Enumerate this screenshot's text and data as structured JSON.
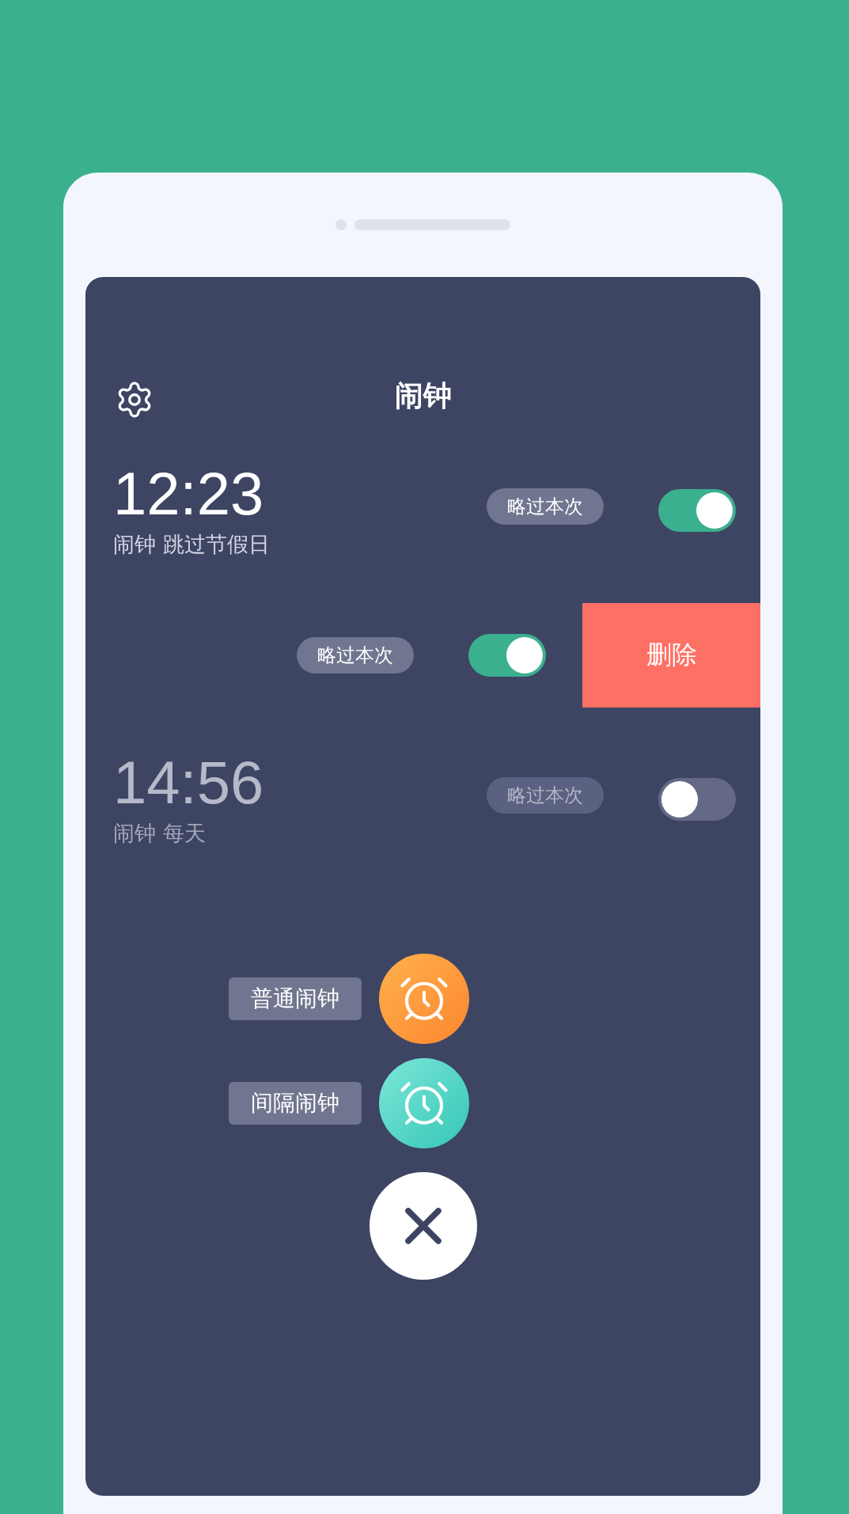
{
  "header": {
    "title": "闹钟"
  },
  "alarms": [
    {
      "time": "12:23",
      "label": "闹钟 跳过节假日",
      "skip_label": "略过本次",
      "enabled": true,
      "swiped": false
    },
    {
      "skip_label": "略过本次",
      "enabled": true,
      "swiped": true,
      "delete_label": "删除"
    },
    {
      "time": "14:56",
      "label": "闹钟 每天",
      "skip_label": "略过本次",
      "enabled": false,
      "swiped": false
    }
  ],
  "add_menu": [
    {
      "label": "普通闹钟",
      "kind": "normal"
    },
    {
      "label": "间隔闹钟",
      "kind": "interval"
    }
  ]
}
